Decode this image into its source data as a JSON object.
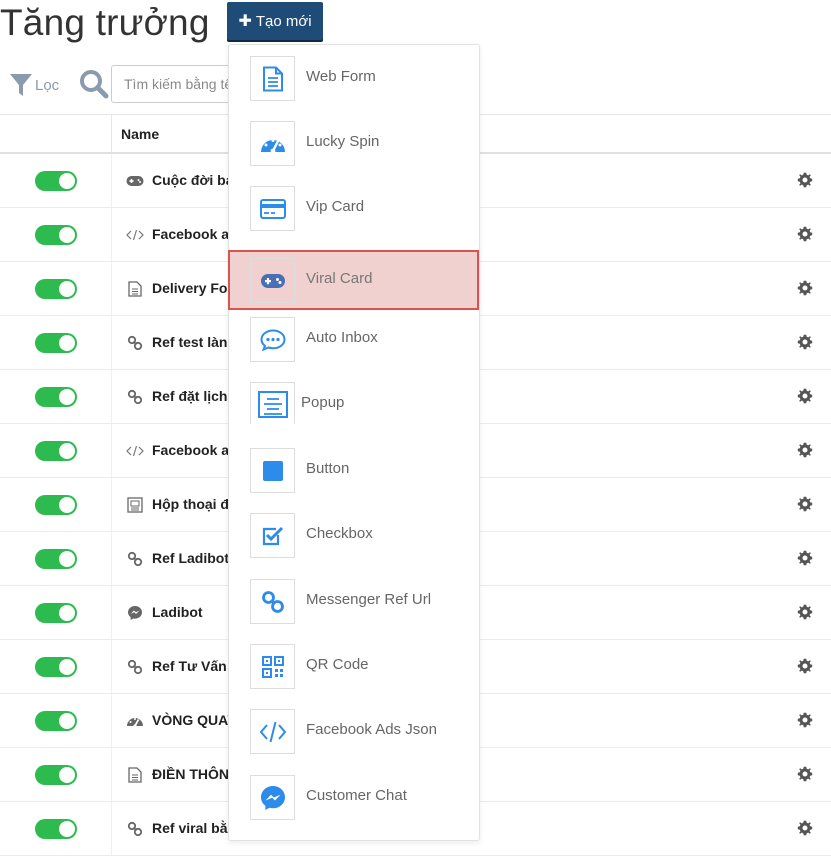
{
  "header": {
    "title": "Tăng trưởng",
    "create_button": "Tạo mới"
  },
  "filter": {
    "filter_label": "Lọc",
    "search_placeholder": "Tìm kiếm bằng tên"
  },
  "table": {
    "columns": [
      "Name"
    ],
    "rows": [
      {
        "icon": "gamepad-icon",
        "name": "Cuộc đời ba",
        "enabled": true
      },
      {
        "icon": "code-icon",
        "name": "Facebook a",
        "enabled": true
      },
      {
        "icon": "document-icon",
        "name": "Delivery Fo",
        "enabled": true
      },
      {
        "icon": "link-icon",
        "name": "Ref test làn",
        "enabled": true
      },
      {
        "icon": "link-icon",
        "name": "Ref đặt lịch",
        "enabled": true
      },
      {
        "icon": "code-icon",
        "name": "Facebook a",
        "enabled": true
      },
      {
        "icon": "dialog-icon",
        "name": "Hộp thoại đ",
        "enabled": true
      },
      {
        "icon": "link-icon",
        "name": "Ref Ladibot",
        "enabled": true
      },
      {
        "icon": "messenger-icon",
        "name": "Ladibot",
        "enabled": true
      },
      {
        "icon": "link-icon",
        "name": "Ref Tư Vấn",
        "enabled": true
      },
      {
        "icon": "dashboard-icon",
        "name": "VÒNG QUAY",
        "enabled": true
      },
      {
        "icon": "document-icon",
        "name": "ĐIỀN THÔN",
        "enabled": true
      },
      {
        "icon": "link-icon",
        "name": "Ref viral bằ",
        "enabled": true
      }
    ]
  },
  "dropdown": {
    "items": [
      {
        "label": "Web Form",
        "icon": "web-form-icon"
      },
      {
        "label": "Lucky Spin",
        "icon": "lucky-spin-icon"
      },
      {
        "label": "Vip Card",
        "icon": "vip-card-icon"
      },
      {
        "label": "Viral Card",
        "icon": "viral-card-icon",
        "highlighted": true
      },
      {
        "label": "Auto Inbox",
        "icon": "auto-inbox-icon"
      },
      {
        "label": "Popup",
        "icon": "popup-icon"
      },
      {
        "label": "Button",
        "icon": "button-icon"
      },
      {
        "label": "Checkbox",
        "icon": "checkbox-icon"
      },
      {
        "label": "Messenger Ref Url",
        "icon": "messenger-ref-url-icon"
      },
      {
        "label": "QR Code",
        "icon": "qr-code-icon"
      },
      {
        "label": "Facebook Ads Json",
        "icon": "facebook-ads-json-icon"
      },
      {
        "label": "Customer Chat",
        "icon": "customer-chat-icon"
      }
    ]
  },
  "colors": {
    "create_button_bg": "#1f4b77",
    "toggle_on": "#2dbb4f",
    "icon_blue": "#2d8ceb",
    "highlight_border": "#d9534f",
    "highlight_bg": "#f1d0d0"
  }
}
